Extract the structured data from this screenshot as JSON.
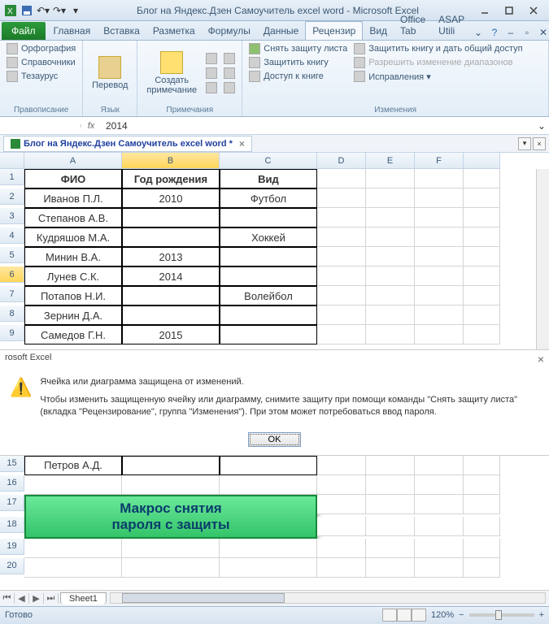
{
  "title": "Блог на Яндекс.Дзен Самоучитель excel word  -  Microsoft Excel",
  "file_tab": "Файл",
  "tabs": [
    "Главная",
    "Вставка",
    "Разметка",
    "Формулы",
    "Данные",
    "Рецензир",
    "Вид",
    "Office Tab",
    "ASAP Utili"
  ],
  "active_tab_index": 5,
  "ribbon": {
    "g1": {
      "items": [
        "Орфография",
        "Справочники",
        "Тезаурус"
      ],
      "label": "Правописание"
    },
    "g2": {
      "btn": "Перевод",
      "label": "Язык"
    },
    "g3": {
      "btn": "Создать примечание",
      "label": "Примечания"
    },
    "g4": {
      "items": [
        "Снять защиту листа",
        "Защитить книгу",
        "Доступ к книге",
        "Защитить книгу и дать общий доступ",
        "Разрешить изменение диапазонов",
        "Исправления ▾"
      ],
      "label": "Изменения"
    }
  },
  "namebox": "",
  "fx": "fx",
  "formula_value": "2014",
  "file_tab_label": "Блог на Яндекс.Дзен Самоучитель excel word *",
  "cols": [
    "A",
    "B",
    "C",
    "D",
    "E",
    "F"
  ],
  "headers": {
    "A": "ФИО",
    "B": "Год рождения",
    "C": "Вид"
  },
  "rows": [
    {
      "n": 1
    },
    {
      "n": 2,
      "A": "Иванов П.Л.",
      "B": "2010",
      "C": "Футбол"
    },
    {
      "n": 3,
      "A": "Степанов А.В."
    },
    {
      "n": 4,
      "A": "Кудряшов М.А.",
      "C": "Хоккей"
    },
    {
      "n": 5,
      "A": "Минин В.А.",
      "B": "2013"
    },
    {
      "n": 6,
      "A": "Лунев С.К.",
      "B": "2014"
    },
    {
      "n": 7,
      "A": "Потапов Н.И.",
      "C": "Волейбол"
    },
    {
      "n": 8,
      "A": "Зернин Д.А."
    },
    {
      "n": 9,
      "A": "Самедов Г.Н.",
      "B": "2015"
    }
  ],
  "active_cell": "B6",
  "dialog": {
    "app": "rosoft Excel",
    "line1": "Ячейка или диаграмма защищена от изменений.",
    "line2": "Чтобы изменить защищенную ячейку или диаграмму, снимите защиту при помощи команды \"Снять защиту листа\" (вкладка \"Рецензирование\", группа \"Изменения\"). При этом может потребоваться ввод пароля.",
    "ok": "OK"
  },
  "lower_rows": [
    15,
    16,
    17,
    18,
    19,
    20
  ],
  "row15_A": "Петров А.Д.",
  "macro": {
    "l1": "Макрос снятия",
    "l2": "пароля с защиты"
  },
  "sheet": "Sheet1",
  "status": "Готово",
  "zoom": "120%"
}
